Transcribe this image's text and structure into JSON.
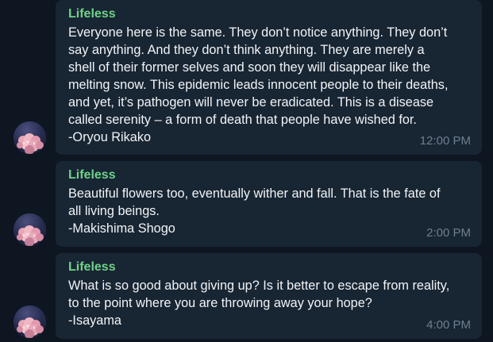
{
  "messages": [
    {
      "sender": "Lifeless",
      "lines": [
        "Everyone here is the same. They don’t notice anything. They don’t",
        "say anything. And they don’t think anything. They are merely a",
        "shell of their former selves and soon they will disappear like the",
        "melting snow. This epidemic leads innocent people to their deaths,",
        "and yet, it’s pathogen will never be eradicated. This is a disease",
        "called serenity – a form of death that people have wished for.",
        "-Oryou Rikako"
      ],
      "time": "12:00 PM"
    },
    {
      "sender": "Lifeless",
      "lines": [
        "Beautiful flowers too, eventually wither and fall. That is the fate of",
        "all living beings.",
        "-Makishima Shogo"
      ],
      "time": "2:00 PM"
    },
    {
      "sender": "Lifeless",
      "lines": [
        "What is so good about giving up? Is it better to escape from reality,",
        "to the point where you are throwing away your hope?",
        "-Isayama"
      ],
      "time": "4:00 PM"
    }
  ]
}
